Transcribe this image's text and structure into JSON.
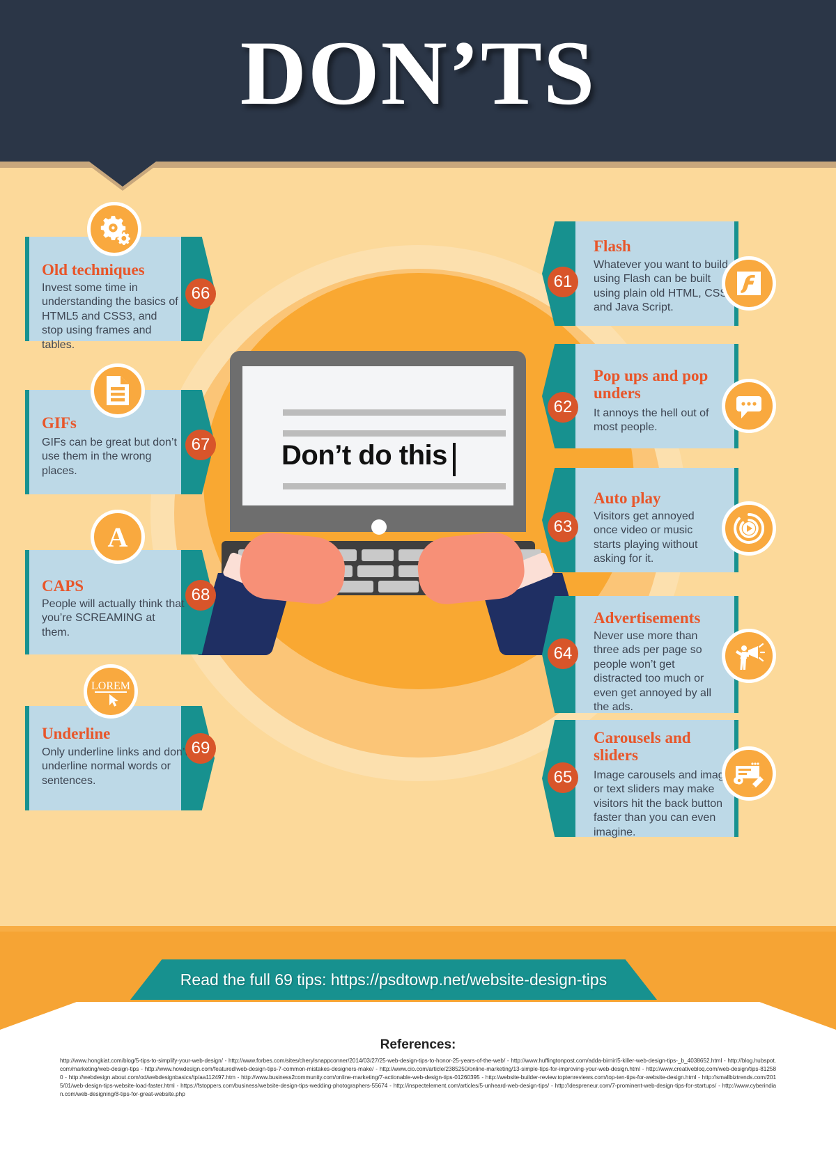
{
  "header": {
    "title": "DON’TS"
  },
  "monitor": {
    "screen_text": "Don’t do this",
    "caret": "|"
  },
  "left_cards": [
    {
      "number": "66",
      "title": "Old techniques",
      "text": "Invest some time in understanding the basics of HTML5 and CSS3, and stop using frames and tables.",
      "icon": "gears-icon"
    },
    {
      "number": "67",
      "title": "GIFs",
      "text": "GIFs can be great but don’t use them in the wrong places.",
      "icon": "document-icon"
    },
    {
      "number": "68",
      "title": "CAPS",
      "text": "People will actually think that you’re SCREAMING at them.",
      "icon": "letter-a-icon"
    },
    {
      "number": "69",
      "title": "Underline",
      "text": "Only underline links and don’t underline normal words or sentences.",
      "icon": "lorem-underline-cursor-icon",
      "icon_label": "LOREM"
    }
  ],
  "right_cards": [
    {
      "number": "61",
      "title": "Flash",
      "text": "Whatever you want to build using Flash can be built using plain old HTML, CSS and Java Script.",
      "icon": "flash-logo-icon"
    },
    {
      "number": "62",
      "title": "Pop ups and pop unders",
      "text": "It annoys the hell out of most people.",
      "icon": "speech-bubble-icon"
    },
    {
      "number": "63",
      "title": "Auto play",
      "text": "Visitors get annoyed once video or music starts playing without asking for it.",
      "icon": "play-button-icon"
    },
    {
      "number": "64",
      "title": "Advertisements",
      "text": "Never use more than three ads per page so people won’t get  distracted too much or even get annoyed by all the ads.",
      "icon": "megaphone-person-icon"
    },
    {
      "number": "65",
      "title": "Carousels and sliders",
      "text": "Image carousels and image or text sliders may make visitors hit the back button faster than you can even imagine.",
      "icon": "slider-editor-icon"
    }
  ],
  "banner": {
    "text": "Read the full 69 tips: https://psdtowp.net/website-design-tips"
  },
  "references": {
    "heading": "References:",
    "text": "http://www.hongkiat.com/blog/5-tips-to-simplify-your-web-design/ - http://www.forbes.com/sites/cherylsnappconner/2014/03/27/25-web-design-tips-to-honor-25-years-of-the-web/ - http://www.huffingtonpost.com/adda-birnir/5-killer-web-design-tips-_b_4038652.html - http://blog.hubspot.com/marketing/web-design-tips - http://www.howdesign.com/featured/web-design-tips-7-common-mistakes-designers-make/ - http://www.cio.com/article/2385250/online-marketing/13-simple-tips-for-improving-your-web-design.html - http://www.creativebloq.com/web-design/tips-812580 - http://webdesign.about.com/od/webdesignbasics/tp/aa112497.htm - http://www.business2community.com/online-marketing/7-actionable-web-design-tips-01260395 - http://website-builder-review.toptenreviews.com/top-ten-tips-for-website-design.html - http://smallbiztrends.com/2015/01/web-design-tips-website-load-faster.html - https://fstoppers.com/business/website-design-tips-wedding-photographers-55674 - http://inspectelement.com/articles/5-unheard-web-design-tips/ - http://despreneur.com/7-prominent-web-design-tips-for-startups/ - http://www.cyberindian.com/web-designing/8-tips-for-great-website.php"
  },
  "colors": {
    "header_bg": "#2b3647",
    "page_bg": "#fcd99a",
    "card_bg": "#bdd9e7",
    "teal": "#17918f",
    "orange": "#f9a93f",
    "badge": "#d8552a",
    "title_orange": "#e8562a",
    "desk": "#f6a434"
  }
}
